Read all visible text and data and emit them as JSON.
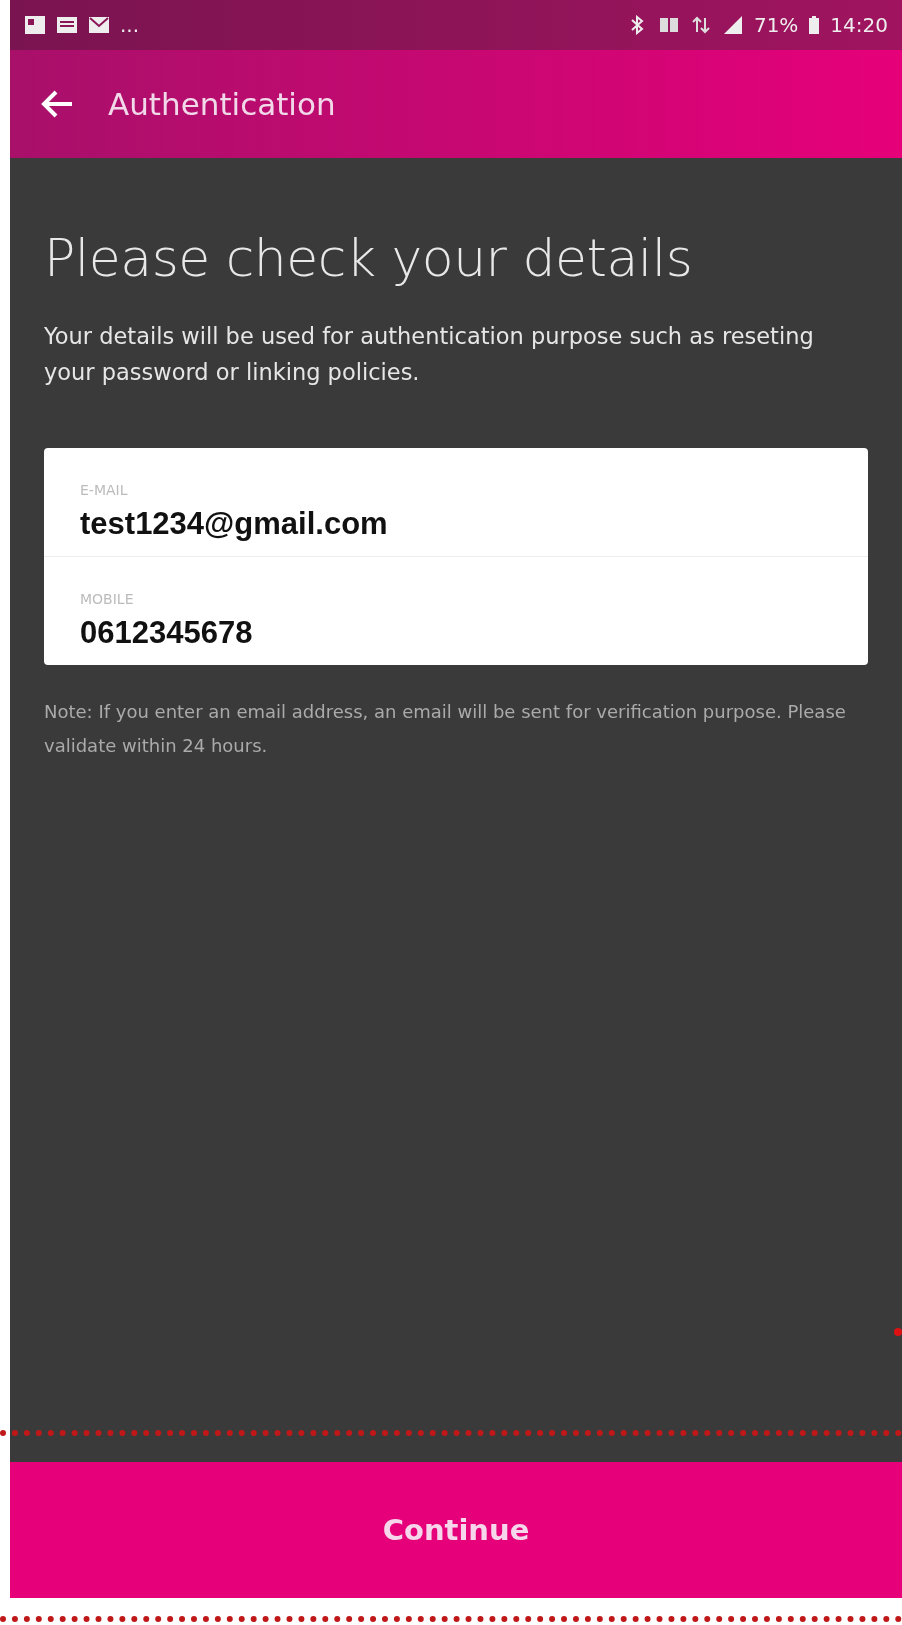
{
  "status_bar": {
    "overflow": "...",
    "battery": "71%",
    "time": "14:20"
  },
  "app_bar": {
    "title": "Authentication"
  },
  "heading": "Please check your details",
  "intro": "Your details will be used for authentication purpose such as reseting your password or linking policies.",
  "fields": [
    {
      "label": "E-MAIL",
      "value": "test1234@gmail.com"
    },
    {
      "label": "MOBILE",
      "value": "0612345678"
    }
  ],
  "note": "Note: If you enter an email address, an email will be sent for verification purpose. Please validate within 24 hours.",
  "buttons": [
    "Continue"
  ]
}
